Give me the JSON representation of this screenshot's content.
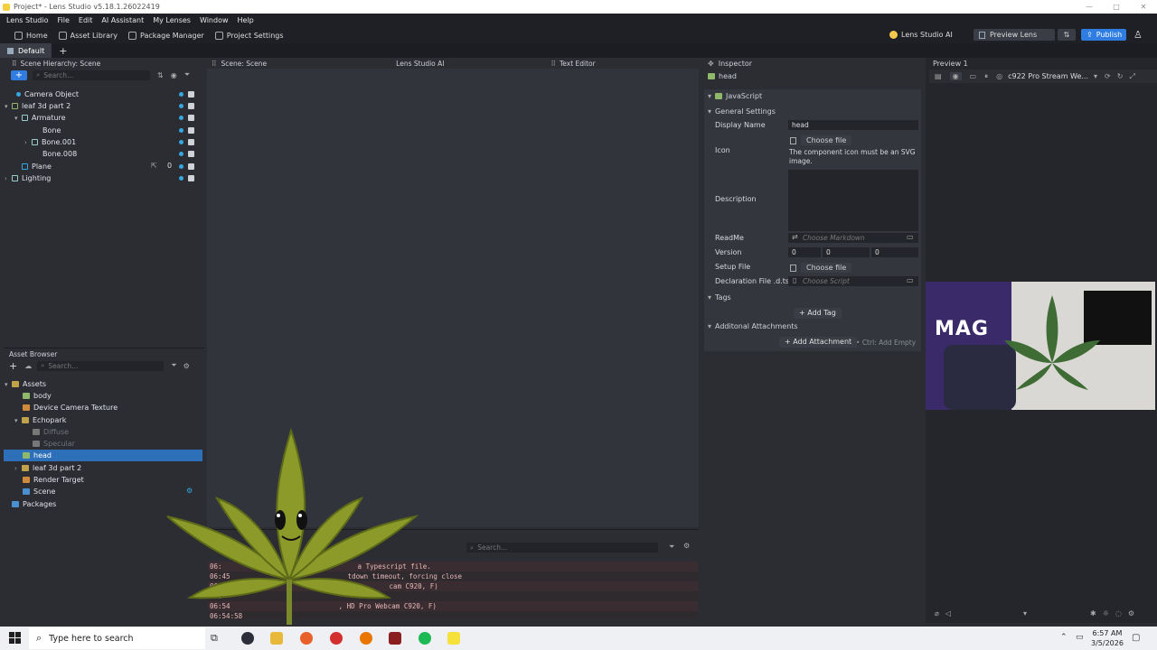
{
  "window": {
    "title": "Project* - Lens Studio v5.18.1.26022419",
    "buttons": [
      "—",
      "□",
      "✕"
    ]
  },
  "menu": [
    "Lens Studio",
    "File",
    "Edit",
    "AI Assistant",
    "My Lenses",
    "Window",
    "Help"
  ],
  "toolbar": {
    "items": [
      "Home",
      "Asset Library",
      "Package Manager",
      "Project Settings"
    ],
    "ai_label": "Lens Studio AI",
    "preview_label": "Preview Lens",
    "publish_label": "Publish"
  },
  "tabs": {
    "default": "Default",
    "add": "+"
  },
  "hierarchy": {
    "title": "Scene Hierarchy: Scene",
    "search_placeholder": "Search...",
    "items": [
      {
        "label": "Camera Object"
      },
      {
        "label": "leaf 3d part 2"
      },
      {
        "label": "Armature"
      },
      {
        "label": "Bone"
      },
      {
        "label": "Bone.001"
      },
      {
        "label": "Bone.008"
      },
      {
        "label": "Plane",
        "badge": "0"
      },
      {
        "label": "Lighting"
      }
    ]
  },
  "asset_browser": {
    "title": "Asset Browser",
    "search_placeholder": "Search...",
    "items": [
      {
        "label": "Assets"
      },
      {
        "label": "body"
      },
      {
        "label": "Device Camera Texture"
      },
      {
        "label": "Echopark"
      },
      {
        "label": "Diffuse"
      },
      {
        "label": "Specular"
      },
      {
        "label": "head"
      },
      {
        "label": "leaf 3d part 2"
      },
      {
        "label": "Render Target"
      },
      {
        "label": "Scene"
      },
      {
        "label": "Packages"
      }
    ]
  },
  "center_tabs": [
    "Scene: Scene",
    "Lens Studio AI",
    "Text Editor"
  ],
  "console": {
    "search_placeholder": "Search...",
    "lines": [
      {
        "time": "06:",
        "text": "a Typescript file."
      },
      {
        "time": "06:45",
        "text": "tdown timeout, forcing close"
      },
      {
        "time": "06:",
        "text": "cam C920, F)"
      },
      {
        "time": "06:",
        "text": ""
      },
      {
        "time": "06:54",
        "text": ", HD Pro Webcam C920, F)"
      },
      {
        "time": "06:54:58",
        "text": ""
      }
    ]
  },
  "inspector": {
    "title": "Inspector",
    "object_name": "head",
    "component": "JavaScript",
    "general_settings": "General Settings",
    "display_name_label": "Display Name",
    "display_name_value": "head",
    "icon_label": "Icon",
    "choose_file": "Choose file",
    "icon_note": "The component icon must be an SVG image.",
    "description_label": "Description",
    "readme_label": "ReadMe",
    "readme_placeholder": "Choose Markdown",
    "version_label": "Version",
    "version_values": [
      "0",
      "0",
      "0"
    ],
    "setup_file_label": "Setup File",
    "setup_choose": "Choose file",
    "declaration_label": "Declaration File .d.ts",
    "declaration_placeholder": "Choose Script",
    "tags_label": "Tags",
    "add_tag": "Add Tag",
    "attachments_label": "Additonal Attachments",
    "add_attachment": "Add Attachment",
    "add_empty_hint": "Ctrl: Add Empty"
  },
  "preview": {
    "title": "Preview 1",
    "camera": "c922 Pro Stream We...",
    "webcam_text": "MAG"
  },
  "taskbar": {
    "search_placeholder": "Type here to search",
    "time": "6:57 AM",
    "date": "3/5/2026"
  }
}
